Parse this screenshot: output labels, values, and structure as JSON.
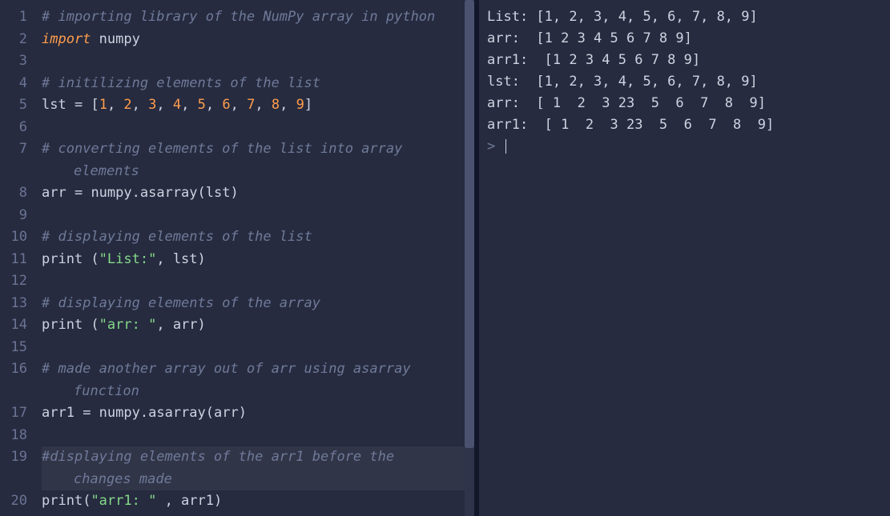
{
  "editor": {
    "lines": [
      {
        "n": 1,
        "tokens": [
          [
            "# importing library of the NumPy array in python",
            "comment"
          ]
        ]
      },
      {
        "n": 2,
        "tokens": [
          [
            "import",
            "keyword"
          ],
          [
            " ",
            "punct"
          ],
          [
            "numpy",
            "ident"
          ]
        ]
      },
      {
        "n": 3,
        "tokens": [
          [
            "",
            ""
          ]
        ]
      },
      {
        "n": 4,
        "tokens": [
          [
            "# initilizing elements of the list",
            "comment"
          ]
        ]
      },
      {
        "n": 5,
        "tokens": [
          [
            "lst ",
            "ident"
          ],
          [
            "=",
            "punct"
          ],
          [
            " [",
            "punct"
          ],
          [
            "1",
            "num"
          ],
          [
            ", ",
            "punct"
          ],
          [
            "2",
            "num"
          ],
          [
            ", ",
            "punct"
          ],
          [
            "3",
            "num"
          ],
          [
            ", ",
            "punct"
          ],
          [
            "4",
            "num"
          ],
          [
            ", ",
            "punct"
          ],
          [
            "5",
            "num"
          ],
          [
            ", ",
            "punct"
          ],
          [
            "6",
            "num"
          ],
          [
            ", ",
            "punct"
          ],
          [
            "7",
            "num"
          ],
          [
            ", ",
            "punct"
          ],
          [
            "8",
            "num"
          ],
          [
            ", ",
            "punct"
          ],
          [
            "9",
            "num"
          ],
          [
            "]",
            "punct"
          ]
        ]
      },
      {
        "n": 6,
        "tokens": [
          [
            "",
            ""
          ]
        ]
      },
      {
        "n": 7,
        "tokens": [
          [
            "# converting elements of the list into array",
            "comment"
          ]
        ],
        "wrap": [
          [
            "elements",
            "comment"
          ]
        ]
      },
      {
        "n": 8,
        "tokens": [
          [
            "arr ",
            "ident"
          ],
          [
            "=",
            "punct"
          ],
          [
            " numpy",
            "ident"
          ],
          [
            ".",
            "punct"
          ],
          [
            "asarray",
            "func"
          ],
          [
            "(",
            "punct"
          ],
          [
            "lst",
            "ident"
          ],
          [
            ")",
            "punct"
          ]
        ]
      },
      {
        "n": 9,
        "tokens": [
          [
            "",
            ""
          ]
        ]
      },
      {
        "n": 10,
        "tokens": [
          [
            "# displaying elements of the list",
            "comment"
          ]
        ]
      },
      {
        "n": 11,
        "tokens": [
          [
            "print ",
            "ident"
          ],
          [
            "(",
            "punct"
          ],
          [
            "\"List:\"",
            "str"
          ],
          [
            ", ",
            "punct"
          ],
          [
            "lst",
            "ident"
          ],
          [
            ")",
            "punct"
          ]
        ]
      },
      {
        "n": 12,
        "tokens": [
          [
            "",
            ""
          ]
        ]
      },
      {
        "n": 13,
        "tokens": [
          [
            "# displaying elements of the array",
            "comment"
          ]
        ]
      },
      {
        "n": 14,
        "tokens": [
          [
            "print ",
            "ident"
          ],
          [
            "(",
            "punct"
          ],
          [
            "\"arr: \"",
            "str"
          ],
          [
            ", ",
            "punct"
          ],
          [
            "arr",
            "ident"
          ],
          [
            ")",
            "punct"
          ]
        ]
      },
      {
        "n": 15,
        "tokens": [
          [
            "",
            ""
          ]
        ]
      },
      {
        "n": 16,
        "tokens": [
          [
            "# made another array out of arr using asarray",
            "comment"
          ]
        ],
        "wrap": [
          [
            "function",
            "comment"
          ]
        ]
      },
      {
        "n": 17,
        "tokens": [
          [
            "arr1 ",
            "ident"
          ],
          [
            "=",
            "punct"
          ],
          [
            " numpy",
            "ident"
          ],
          [
            ".",
            "punct"
          ],
          [
            "asarray",
            "func"
          ],
          [
            "(",
            "punct"
          ],
          [
            "arr",
            "ident"
          ],
          [
            ")",
            "punct"
          ]
        ]
      },
      {
        "n": 18,
        "tokens": [
          [
            "",
            ""
          ]
        ]
      },
      {
        "n": 19,
        "active": true,
        "tokens": [
          [
            "#displaying elements of the arr1 before the",
            "comment"
          ]
        ],
        "wrap": [
          [
            "changes made",
            "comment"
          ]
        ]
      },
      {
        "n": 20,
        "tokens": [
          [
            "print",
            "ident"
          ],
          [
            "(",
            "punct"
          ],
          [
            "\"arr1: \"",
            "str"
          ],
          [
            " , ",
            "punct"
          ],
          [
            "arr1",
            "ident"
          ],
          [
            ")",
            "punct"
          ]
        ]
      }
    ]
  },
  "output": {
    "lines": [
      "List: [1, 2, 3, 4, 5, 6, 7, 8, 9]",
      "arr:  [1 2 3 4 5 6 7 8 9]",
      "arr1:  [1 2 3 4 5 6 7 8 9]",
      "lst:  [1, 2, 3, 4, 5, 6, 7, 8, 9]",
      "arr:  [ 1  2  3 23  5  6  7  8  9]",
      "arr1:  [ 1  2  3 23  5  6  7  8  9]"
    ],
    "prompt": ">"
  }
}
